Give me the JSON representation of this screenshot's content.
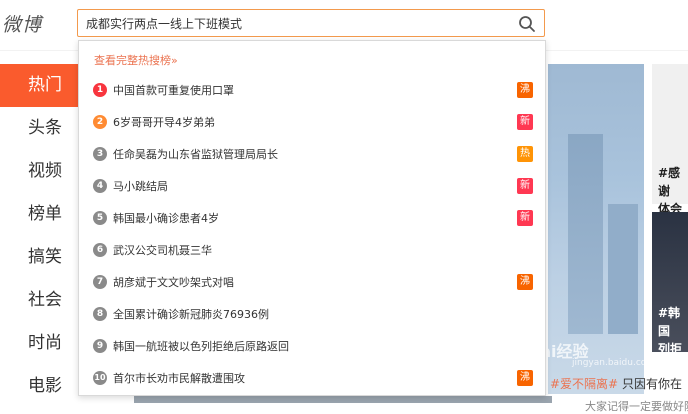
{
  "app": {
    "logo": "微博"
  },
  "search": {
    "value": "成都实行两点一线上下班模式",
    "icon": "search-icon"
  },
  "nav": {
    "items": [
      {
        "label": "热门",
        "active": true
      },
      {
        "label": "头条"
      },
      {
        "label": "视频"
      },
      {
        "label": "榜单"
      },
      {
        "label": "搞笑"
      },
      {
        "label": "社会"
      },
      {
        "label": "时尚"
      },
      {
        "label": "电影"
      }
    ]
  },
  "dropdown": {
    "header": "查看完整热搜榜»",
    "items": [
      {
        "rank": "1",
        "text": "中国首款可重复使用口罩",
        "badge": "沸",
        "badge_color": "#f86400",
        "rank_color": "#f8353e"
      },
      {
        "rank": "2",
        "text": "6岁哥哥开导4岁弟弟",
        "badge": "新",
        "badge_color": "#ff3852",
        "rank_color": "#ff8b33"
      },
      {
        "rank": "3",
        "text": "任命吴磊为山东省监狱管理局局长",
        "badge": "热",
        "badge_color": "#ff9406",
        "rank_color": "#8a8a8a"
      },
      {
        "rank": "4",
        "text": "马小跳结局",
        "badge": "新",
        "badge_color": "#ff3852",
        "rank_color": "#8a8a8a"
      },
      {
        "rank": "5",
        "text": "韩国最小确诊患者4岁",
        "badge": "新",
        "badge_color": "#ff3852",
        "rank_color": "#8a8a8a"
      },
      {
        "rank": "6",
        "text": "武汉公交司机聂三华",
        "badge": "",
        "badge_color": "",
        "rank_color": "#8a8a8a"
      },
      {
        "rank": "7",
        "text": "胡彦斌于文文吵架式对唱",
        "badge": "沸",
        "badge_color": "#f86400",
        "rank_color": "#8a8a8a"
      },
      {
        "rank": "8",
        "text": "全国累计确诊新冠肺炎76936例",
        "badge": "",
        "badge_color": "",
        "rank_color": "#8a8a8a"
      },
      {
        "rank": "9",
        "text": "韩国一航班被以色列拒绝后原路返回",
        "badge": "",
        "badge_color": "",
        "rank_color": "#8a8a8a"
      },
      {
        "rank": "10",
        "text": "首尔市长劝市民解散遭围攻",
        "badge": "沸",
        "badge_color": "#f86400",
        "rank_color": "#8a8a8a"
      }
    ]
  },
  "cards": {
    "tag1": "#感谢\n体会",
    "tag2": "#韩国\n列拒"
  },
  "bottom": {
    "hashtag": "#爱不隔离#",
    "text": " 只因有你在",
    "text2": "大家记得一定要做好防护"
  },
  "watermark": {
    "main": "Bai经验",
    "sub": "jingyan.baidu.com"
  }
}
